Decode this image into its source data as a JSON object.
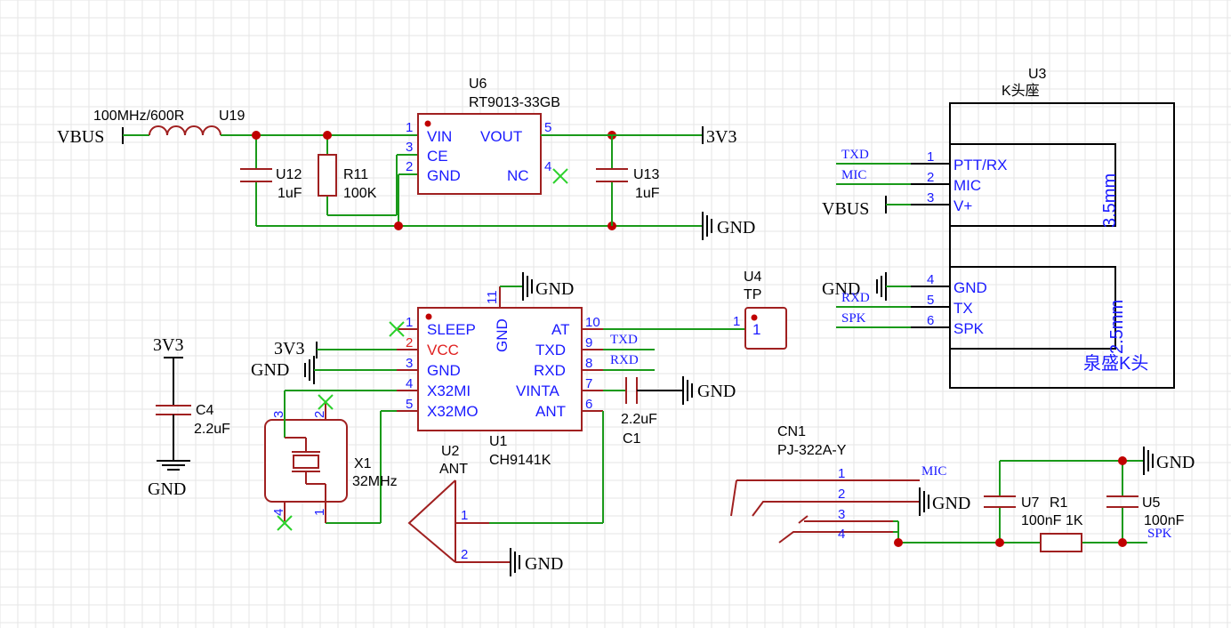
{
  "colors": {
    "wire": "#1a9a1a",
    "component": "#a02020",
    "pin_text": "#1a1aff",
    "junction": "#c00000",
    "no_connect": "#2bd12b",
    "vcc_pin": "#e02020"
  },
  "nets": {
    "vbus": "VBUS",
    "v3v3": "3V3",
    "gnd": "GND",
    "txd": "TXD",
    "rxd": "RXD",
    "mic": "MIC",
    "spk": "SPK"
  },
  "u19": {
    "designator": "U19",
    "value": "100MHz/600R"
  },
  "u6": {
    "designator": "U6",
    "value": "RT9013-33GB",
    "pins": [
      {
        "num": "1",
        "name": "VIN"
      },
      {
        "num": "3",
        "name": "CE"
      },
      {
        "num": "2",
        "name": "GND"
      },
      {
        "num": "5",
        "name": "VOUT"
      },
      {
        "num": "4",
        "name": "NC"
      }
    ]
  },
  "u12": {
    "designator": "U12",
    "value": "1uF"
  },
  "r11": {
    "designator": "R11",
    "value": "100K"
  },
  "u13": {
    "designator": "U13",
    "value": "1uF"
  },
  "u3": {
    "designator": "U3",
    "value": "K头座",
    "pins": [
      {
        "num": "1",
        "name": "PTT/RX"
      },
      {
        "num": "2",
        "name": "MIC"
      },
      {
        "num": "3",
        "name": "V+"
      },
      {
        "num": "4",
        "name": "GND"
      },
      {
        "num": "5",
        "name": "TX"
      },
      {
        "num": "6",
        "name": "SPK"
      }
    ],
    "label_35": "3.5mm",
    "label_25": "2.5mm",
    "label_brand": "泉盛K头"
  },
  "u4": {
    "designator": "U4",
    "value": "TP",
    "pin_num": "1",
    "pin_name": "1"
  },
  "c4": {
    "designator": "C4",
    "value": "2.2uF"
  },
  "u1": {
    "designator": "U1",
    "value": "CH9141K",
    "left_pins": [
      {
        "num": "1",
        "name": "SLEEP"
      },
      {
        "num": "2",
        "name": "VCC"
      },
      {
        "num": "3",
        "name": "GND"
      },
      {
        "num": "4",
        "name": "X32MI"
      },
      {
        "num": "5",
        "name": "X32MO"
      }
    ],
    "right_pins": [
      {
        "num": "10",
        "name": "AT"
      },
      {
        "num": "9",
        "name": "TXD"
      },
      {
        "num": "8",
        "name": "RXD"
      },
      {
        "num": "7",
        "name": "VINTA"
      },
      {
        "num": "6",
        "name": "ANT"
      }
    ],
    "top_pin": {
      "num": "11",
      "name": "GND"
    }
  },
  "c1": {
    "designator": "C1",
    "value": "2.2uF"
  },
  "x1": {
    "designator": "X1",
    "value": "32MHz",
    "pins": [
      "3",
      "2",
      "4",
      "1"
    ]
  },
  "u2": {
    "designator": "U2",
    "value": "ANT",
    "pins": [
      "1",
      "2"
    ]
  },
  "cn1": {
    "designator": "CN1",
    "value": "PJ-322A-Y",
    "pins": [
      "1",
      "2",
      "3",
      "4"
    ]
  },
  "u7": {
    "designator": "U7",
    "value": "100nF"
  },
  "r1": {
    "designator": "R1",
    "value": "1K"
  },
  "u5": {
    "designator": "U5",
    "value": "100nF"
  }
}
